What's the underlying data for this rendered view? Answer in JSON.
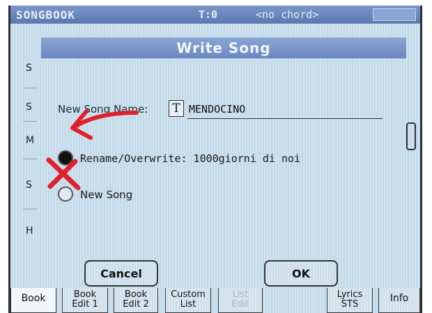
{
  "titlebar": {
    "app": "SONGBOOK",
    "tempo": "T:0",
    "chord": "<no chord>"
  },
  "left_column": [
    "S",
    "S",
    "M",
    "S",
    "H"
  ],
  "dialog": {
    "title": "Write Song",
    "name_label": "New Song Name:",
    "text_icon": "T",
    "name_value": "MENDOCINO",
    "option_rename": "Rename/Overwrite: 1000giorni di noi",
    "option_new": "New Song",
    "selected_option": "rename",
    "cancel_label": "Cancel",
    "ok_label": "OK"
  },
  "tabs": [
    {
      "line1": "Book",
      "line2": ""
    },
    {
      "line1": "Book",
      "line2": "Edit 1"
    },
    {
      "line1": "Book",
      "line2": "Edit 2"
    },
    {
      "line1": "Custom",
      "line2": "List"
    },
    {
      "line1": "List",
      "line2": "Edit"
    },
    {
      "line1": "Lyrics",
      "line2": "STS"
    },
    {
      "line1": "Info",
      "line2": ""
    }
  ],
  "annotations": {
    "arrow_color": "#e0202a",
    "cross_color": "#e0202a"
  }
}
